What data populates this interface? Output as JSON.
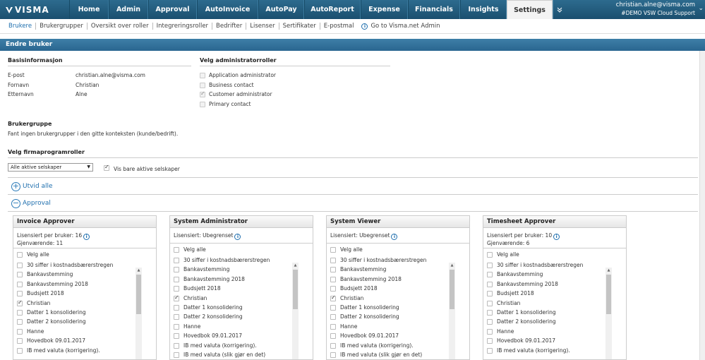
{
  "brand": {
    "logo_text": "VISMA"
  },
  "nav": {
    "tabs": [
      "Home",
      "Admin",
      "Approval",
      "AutoInvoice",
      "AutoPay",
      "AutoReport",
      "Expense",
      "Financials",
      "Insights",
      "Settings"
    ],
    "active_tab": "Settings",
    "more_icon": "chevron-double-down-icon"
  },
  "user": {
    "email": "christian.alne@visma.com",
    "company": "#DEMO VSW Cloud Support"
  },
  "subnav": {
    "items": [
      "Brukere",
      "Brukergrupper",
      "Oversikt over roller",
      "Integreringsroller",
      "Bedrifter",
      "Lisenser",
      "Sertifikater",
      "E-postmal"
    ],
    "active": "Brukere",
    "admin_link": "Go to Visma.net Admin"
  },
  "panel": {
    "title": "Endre bruker"
  },
  "basis": {
    "heading": "Basisinformasjon",
    "fields": [
      {
        "label": "E-post",
        "value": "christian.alne@visma.com"
      },
      {
        "label": "Fornavn",
        "value": "Christian"
      },
      {
        "label": "Etternavn",
        "value": "Alne"
      }
    ]
  },
  "admin_roles": {
    "heading": "Velg administratorroller",
    "items": [
      {
        "label": "Application administrator",
        "checked": false
      },
      {
        "label": "Business contact",
        "checked": false
      },
      {
        "label": "Customer administrator",
        "checked": true
      },
      {
        "label": "Primary contact",
        "checked": false
      }
    ]
  },
  "usergroup": {
    "heading": "Brukergruppe",
    "message": "Fant ingen brukergrupper i den gitte konteksten (kunde/bedrift)."
  },
  "firm_roles": {
    "heading": "Velg firmaprogramroller",
    "company_select": "Alle aktive selskaper",
    "only_active_label": "Vis bare aktive selskaper",
    "only_active_checked": true,
    "expand_all": "Utvid alle",
    "section": "Approval"
  },
  "cards": [
    {
      "title": "Invoice Approver",
      "license": "Lisensiert per bruker: 16",
      "remaining": "Gjenværende: 11",
      "select_all": "Velg alle",
      "items": [
        {
          "label": "30 siffer i kostnadsbærerstregen",
          "checked": false
        },
        {
          "label": "Bankavstemming",
          "checked": false
        },
        {
          "label": "Bankavstemming 2018",
          "checked": false
        },
        {
          "label": "Budsjett 2018",
          "checked": false
        },
        {
          "label": "Christian",
          "checked": true
        },
        {
          "label": "Datter 1 konsolidering",
          "checked": false
        },
        {
          "label": "Datter 2 konsolidering",
          "checked": false
        },
        {
          "label": "Hanne",
          "checked": false
        },
        {
          "label": "Hovedbok 09.01.2017",
          "checked": false
        },
        {
          "label": "IB med valuta (korrigering).",
          "checked": false
        }
      ]
    },
    {
      "title": "System Administrator",
      "license": "Lisensiert: Ubegrenset",
      "remaining": "",
      "select_all": "Velg alle",
      "items": [
        {
          "label": "30 siffer i kostnadsbærerstregen",
          "checked": false
        },
        {
          "label": "Bankavstemming",
          "checked": false
        },
        {
          "label": "Bankavstemming 2018",
          "checked": false
        },
        {
          "label": "Budsjett 2018",
          "checked": false
        },
        {
          "label": "Christian",
          "checked": true
        },
        {
          "label": "Datter 1 konsolidering",
          "checked": false
        },
        {
          "label": "Datter 2 konsolidering",
          "checked": false
        },
        {
          "label": "Hanne",
          "checked": false
        },
        {
          "label": "Hovedbok 09.01.2017",
          "checked": false
        },
        {
          "label": "IB med valuta (korrigering).",
          "checked": false
        },
        {
          "label": "IB med valuta (slik gjør en det)",
          "checked": false
        }
      ]
    },
    {
      "title": "System Viewer",
      "license": "Lisensiert: Ubegrenset",
      "remaining": "",
      "select_all": "Velg alle",
      "items": [
        {
          "label": "30 siffer i kostnadsbærerstregen",
          "checked": false
        },
        {
          "label": "Bankavstemming",
          "checked": false
        },
        {
          "label": "Bankavstemming 2018",
          "checked": false
        },
        {
          "label": "Budsjett 2018",
          "checked": false
        },
        {
          "label": "Christian",
          "checked": true
        },
        {
          "label": "Datter 1 konsolidering",
          "checked": false
        },
        {
          "label": "Datter 2 konsolidering",
          "checked": false
        },
        {
          "label": "Hanne",
          "checked": false
        },
        {
          "label": "Hovedbok 09.01.2017",
          "checked": false
        },
        {
          "label": "IB med valuta (korrigering).",
          "checked": false
        },
        {
          "label": "IB med valuta (slik gjør en det)",
          "checked": false
        }
      ]
    },
    {
      "title": "Timesheet Approver",
      "license": "Lisensiert per bruker: 10",
      "remaining": "Gjenværende: 6",
      "select_all": "Velg alle",
      "items": [
        {
          "label": "30 siffer i kostnadsbærerstregen",
          "checked": false
        },
        {
          "label": "Bankavstemming",
          "checked": false
        },
        {
          "label": "Bankavstemming 2018",
          "checked": false
        },
        {
          "label": "Budsjett 2018",
          "checked": false
        },
        {
          "label": "Christian",
          "checked": false
        },
        {
          "label": "Datter 1 konsolidering",
          "checked": false
        },
        {
          "label": "Datter 2 konsolidering",
          "checked": false
        },
        {
          "label": "Hanne",
          "checked": false
        },
        {
          "label": "Hovedbok 09.01.2017",
          "checked": false
        },
        {
          "label": "IB med valuta (korrigering).",
          "checked": false
        }
      ]
    }
  ],
  "colors": {
    "nav_bg": "#1b4f6f",
    "panel_header": "#2a6690",
    "link": "#1f6fae"
  }
}
